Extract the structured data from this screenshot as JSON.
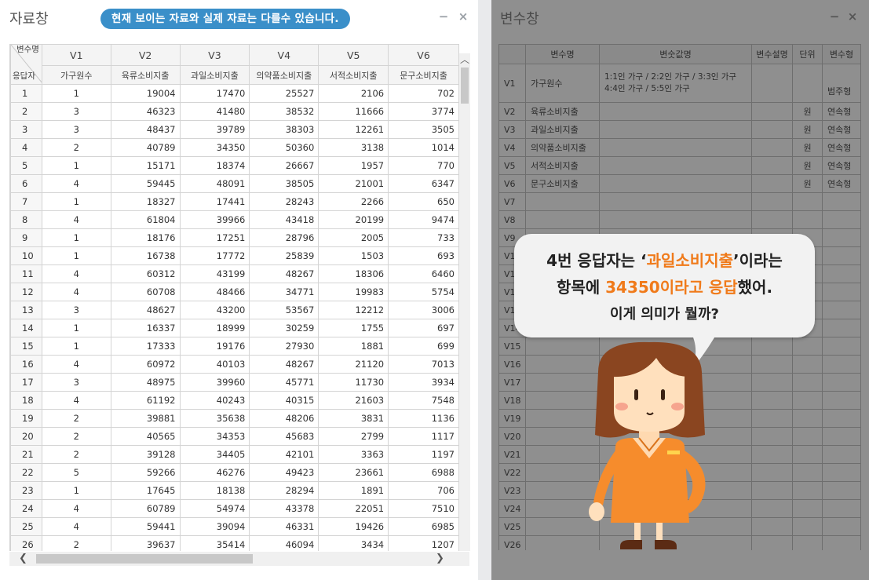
{
  "left_window": {
    "title": "자료창",
    "notice": "현재 보이는 자료와 실제 자료는 다를수 있습니다.",
    "minimize": "−",
    "close": "×"
  },
  "data_grid": {
    "corner_top": "변수명",
    "corner_bottom": "응답자",
    "columns": [
      {
        "code": "V1",
        "name": "가구원수"
      },
      {
        "code": "V2",
        "name": "육류소비지출"
      },
      {
        "code": "V3",
        "name": "과일소비지출"
      },
      {
        "code": "V4",
        "name": "의약품소비지출"
      },
      {
        "code": "V5",
        "name": "서적소비지출"
      },
      {
        "code": "V6",
        "name": "문구소비지출"
      }
    ],
    "rows": [
      [
        "1",
        "1",
        "19004",
        "17470",
        "25527",
        "2106",
        "702"
      ],
      [
        "2",
        "3",
        "46323",
        "41480",
        "38532",
        "11666",
        "3774"
      ],
      [
        "3",
        "3",
        "48437",
        "39789",
        "38303",
        "12261",
        "3505"
      ],
      [
        "4",
        "2",
        "40789",
        "34350",
        "50360",
        "3138",
        "1014"
      ],
      [
        "5",
        "1",
        "15171",
        "18374",
        "26667",
        "1957",
        "770"
      ],
      [
        "6",
        "4",
        "59445",
        "48091",
        "38505",
        "21001",
        "6347"
      ],
      [
        "7",
        "1",
        "18327",
        "17441",
        "28243",
        "2266",
        "650"
      ],
      [
        "8",
        "4",
        "61804",
        "39966",
        "43418",
        "20199",
        "9474"
      ],
      [
        "9",
        "1",
        "18176",
        "17251",
        "28796",
        "2005",
        "733"
      ],
      [
        "10",
        "1",
        "16738",
        "17772",
        "25839",
        "1503",
        "693"
      ],
      [
        "11",
        "4",
        "60312",
        "43199",
        "48267",
        "18306",
        "6460"
      ],
      [
        "12",
        "4",
        "60708",
        "48466",
        "34771",
        "19983",
        "5754"
      ],
      [
        "13",
        "3",
        "48627",
        "43200",
        "53567",
        "12212",
        "3006"
      ],
      [
        "14",
        "1",
        "16337",
        "18999",
        "30259",
        "1755",
        "697"
      ],
      [
        "15",
        "1",
        "17333",
        "19176",
        "27930",
        "1881",
        "699"
      ],
      [
        "16",
        "4",
        "60972",
        "40103",
        "48267",
        "21120",
        "7013"
      ],
      [
        "17",
        "3",
        "48975",
        "39960",
        "45771",
        "11730",
        "3934"
      ],
      [
        "18",
        "4",
        "61192",
        "40243",
        "40315",
        "21603",
        "7548"
      ],
      [
        "19",
        "2",
        "39881",
        "35638",
        "48206",
        "3831",
        "1136"
      ],
      [
        "20",
        "2",
        "40565",
        "34353",
        "45683",
        "2799",
        "1117"
      ],
      [
        "21",
        "2",
        "39128",
        "34405",
        "42101",
        "3363",
        "1197"
      ],
      [
        "22",
        "5",
        "59266",
        "46276",
        "49423",
        "23661",
        "6988"
      ],
      [
        "23",
        "1",
        "17645",
        "18138",
        "28294",
        "1891",
        "706"
      ],
      [
        "24",
        "4",
        "60789",
        "54974",
        "43378",
        "22051",
        "7510"
      ],
      [
        "25",
        "4",
        "59441",
        "39094",
        "46331",
        "19426",
        "6985"
      ],
      [
        "26",
        "2",
        "39637",
        "35414",
        "46094",
        "3434",
        "1207"
      ]
    ]
  },
  "right_window": {
    "title": "변수창",
    "minimize": "−",
    "close": "×"
  },
  "var_grid": {
    "headers": [
      "변수명",
      "변숫값명",
      "변수설명",
      "단위",
      "변수형"
    ],
    "rows": [
      {
        "id": "V1",
        "name": "가구원수",
        "values_line1": "1:1인 가구 / 2:2인 가구 / 3:3인 가구",
        "values_line2": "4:4인 가구 / 5:5인 가구",
        "desc": "",
        "unit": "",
        "type": "범주형"
      },
      {
        "id": "V2",
        "name": "육류소비지출",
        "values_line1": "",
        "values_line2": "",
        "desc": "",
        "unit": "원",
        "type": "연속형"
      },
      {
        "id": "V3",
        "name": "과일소비지출",
        "values_line1": "",
        "values_line2": "",
        "desc": "",
        "unit": "원",
        "type": "연속형"
      },
      {
        "id": "V4",
        "name": "의약품소비지출",
        "values_line1": "",
        "values_line2": "",
        "desc": "",
        "unit": "원",
        "type": "연속형"
      },
      {
        "id": "V5",
        "name": "서적소비지출",
        "values_line1": "",
        "values_line2": "",
        "desc": "",
        "unit": "원",
        "type": "연속형"
      },
      {
        "id": "V6",
        "name": "문구소비지출",
        "values_line1": "",
        "values_line2": "",
        "desc": "",
        "unit": "원",
        "type": "연속형"
      },
      {
        "id": "V7"
      },
      {
        "id": "V8"
      },
      {
        "id": "V9"
      },
      {
        "id": "V10"
      },
      {
        "id": "V11"
      },
      {
        "id": "V12"
      },
      {
        "id": "V13"
      },
      {
        "id": "V14"
      },
      {
        "id": "V15"
      },
      {
        "id": "V16"
      },
      {
        "id": "V17"
      },
      {
        "id": "V18"
      },
      {
        "id": "V19"
      },
      {
        "id": "V20"
      },
      {
        "id": "V21"
      },
      {
        "id": "V22"
      },
      {
        "id": "V23"
      },
      {
        "id": "V24"
      },
      {
        "id": "V25"
      },
      {
        "id": "V26"
      }
    ]
  },
  "bubble": {
    "line1_a": "4번 응답자는 ‘",
    "line1_hl": "과일소비지출",
    "line1_b": "’이라는",
    "line2_a": "항목에 ",
    "line2_hl": "34350이라고 응답",
    "line2_b": "했어.",
    "line3": "이게 의미가 뭘까?"
  },
  "colors": {
    "accent_blue": "#3a8fc9",
    "highlight_orange": "#f07a1a",
    "overlay_gray": "#8f8f8f"
  }
}
